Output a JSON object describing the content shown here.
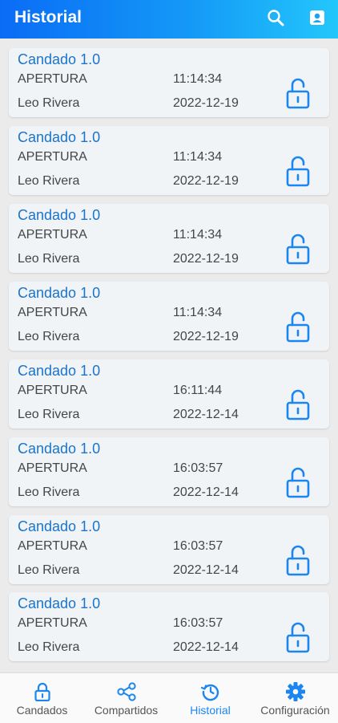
{
  "header": {
    "title": "Historial",
    "icons": [
      "search-icon",
      "contact-card-icon"
    ]
  },
  "colors": {
    "accent": "#1b86f0",
    "card_title": "#1b74c8",
    "lock": "#1b86f0"
  },
  "entries": [
    {
      "device": "Candado 1.0",
      "action": "APERTURA",
      "time": "11:14:34",
      "user": "Leo Rivera",
      "date": "2022-12-19",
      "icon": "unlocked-padlock-icon"
    },
    {
      "device": "Candado 1.0",
      "action": "APERTURA",
      "time": "11:14:34",
      "user": "Leo Rivera",
      "date": "2022-12-19",
      "icon": "unlocked-padlock-icon"
    },
    {
      "device": "Candado 1.0",
      "action": "APERTURA",
      "time": "11:14:34",
      "user": "Leo Rivera",
      "date": "2022-12-19",
      "icon": "unlocked-padlock-icon"
    },
    {
      "device": "Candado 1.0",
      "action": "APERTURA",
      "time": "11:14:34",
      "user": "Leo Rivera",
      "date": "2022-12-19",
      "icon": "unlocked-padlock-icon"
    },
    {
      "device": "Candado 1.0",
      "action": "APERTURA",
      "time": "16:11:44",
      "user": "Leo Rivera",
      "date": "2022-12-14",
      "icon": "unlocked-padlock-icon"
    },
    {
      "device": "Candado 1.0",
      "action": "APERTURA",
      "time": "16:03:57",
      "user": "Leo Rivera",
      "date": "2022-12-14",
      "icon": "unlocked-padlock-icon"
    },
    {
      "device": "Candado 1.0",
      "action": "APERTURA",
      "time": "16:03:57",
      "user": "Leo Rivera",
      "date": "2022-12-14",
      "icon": "unlocked-padlock-icon"
    },
    {
      "device": "Candado 1.0",
      "action": "APERTURA",
      "time": "16:03:57",
      "user": "Leo Rivera",
      "date": "2022-12-14",
      "icon": "unlocked-padlock-icon"
    }
  ],
  "bottom_nav": {
    "items": [
      {
        "label": "Candados",
        "icon": "padlock-icon",
        "active": false
      },
      {
        "label": "Compartidos",
        "icon": "share-icon",
        "active": false
      },
      {
        "label": "Historial",
        "icon": "history-icon",
        "active": true
      },
      {
        "label": "Configuración",
        "icon": "gear-icon",
        "active": false
      }
    ]
  }
}
